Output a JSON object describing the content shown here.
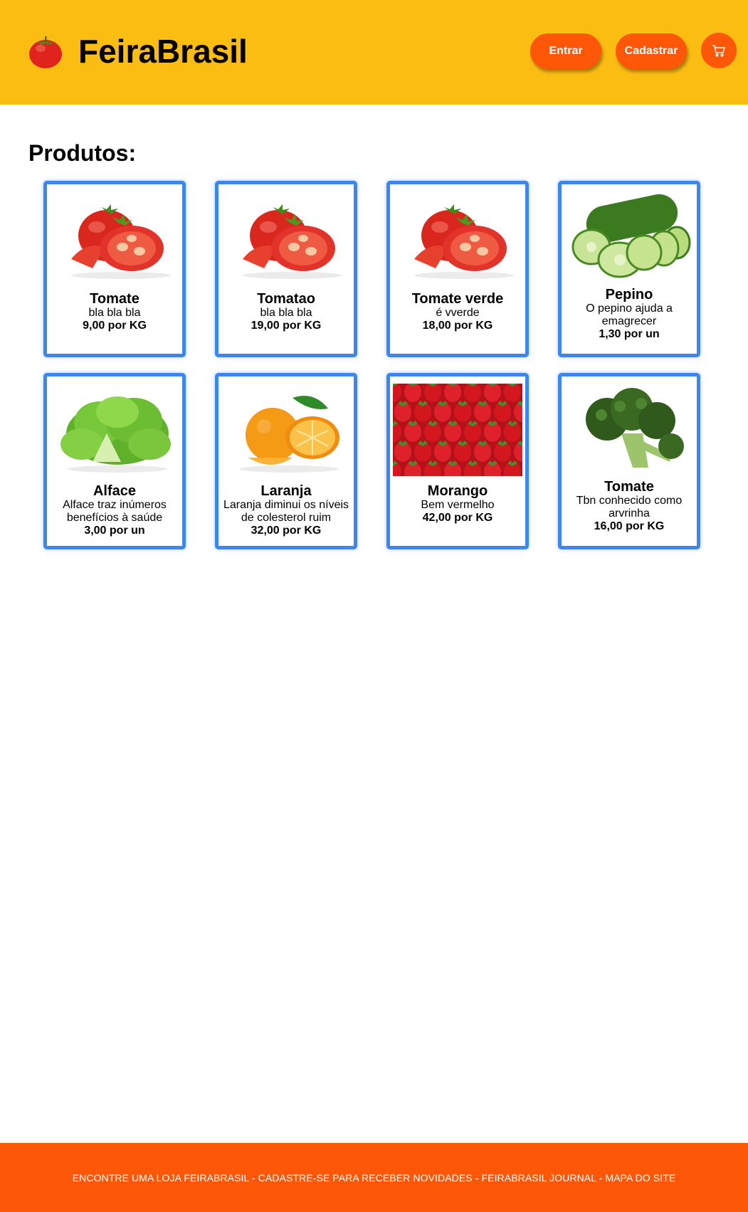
{
  "header": {
    "brand": "FeiraBrasil",
    "logo_icon": "tomato-icon",
    "login_label": "Entrar",
    "signup_label": "Cadastrar",
    "cart_icon": "cart-icon",
    "background": "#fcbd13",
    "accent": "#fe5708"
  },
  "main": {
    "title": "Produtos:",
    "products": [
      {
        "name": "Tomate",
        "description": "bla bla bla",
        "price": "9,00 por KG",
        "image": "tomato"
      },
      {
        "name": "Tomatao",
        "description": "bla bla bla",
        "price": "19,00 por KG",
        "image": "tomato"
      },
      {
        "name": "Tomate verde",
        "description": "é vverde",
        "price": "18,00 por KG",
        "image": "tomato"
      },
      {
        "name": "Pepino",
        "description": "O pepino ajuda a emagrecer",
        "price": "1,30 por un",
        "image": "cucumber"
      },
      {
        "name": "Alface",
        "description": "Alface traz inúmeros benefícios à saúde",
        "price": "3,00 por un",
        "image": "lettuce"
      },
      {
        "name": "Laranja",
        "description": "Laranja diminui os níveis de colesterol ruim",
        "price": "32,00 por KG",
        "image": "orange"
      },
      {
        "name": "Morango",
        "description": "Bem vermelho",
        "price": "42,00 por KG",
        "image": "strawberry"
      },
      {
        "name": "Tomate",
        "description": "Tbn conhecido como arvrinha",
        "price": "16,00 por KG",
        "image": "broccoli"
      }
    ]
  },
  "footer": {
    "text": "ENCONTRE UMA LOJA FEIRABRASIL - CADASTRE-SE PARA RECEBER NOVIDADES - FEIRABRASIL JOURNAL - MAPA DO SITE"
  }
}
